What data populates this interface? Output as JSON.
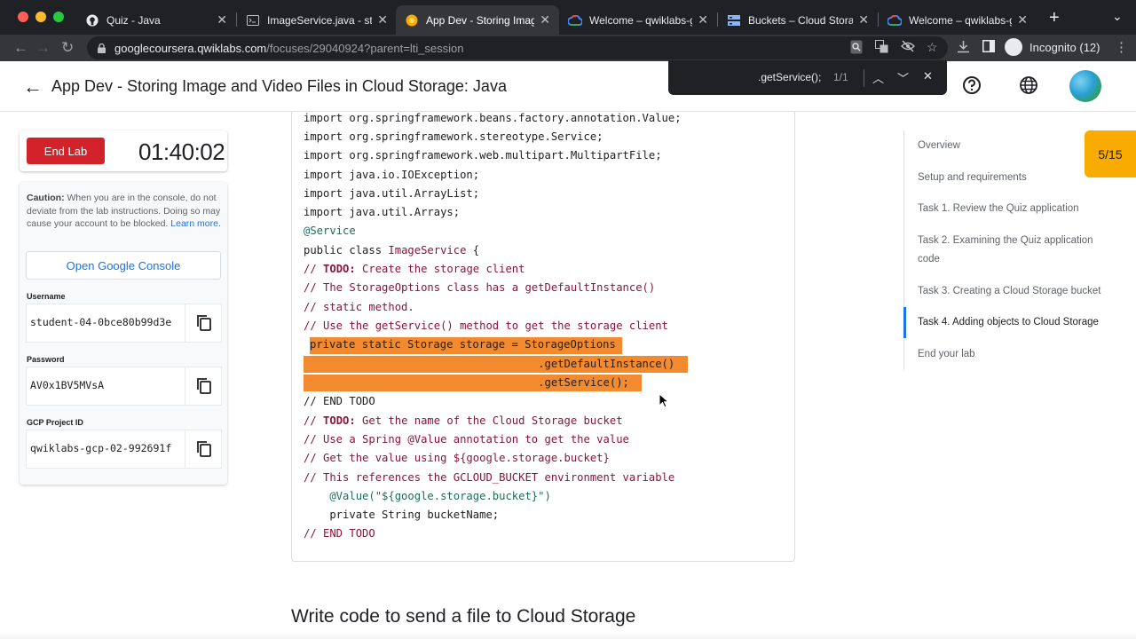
{
  "browser": {
    "tabs": [
      {
        "title": "Quiz - Java",
        "icon": "github-icon",
        "active": false
      },
      {
        "title": "ImageService.java - stud",
        "icon": "code-editor-icon",
        "active": false
      },
      {
        "title": "App Dev - Storing Image",
        "icon": "qwiklabs-icon",
        "active": true
      },
      {
        "title": "Welcome – qwiklabs-gcp",
        "icon": "google-cloud-icon",
        "active": false
      },
      {
        "title": "Buckets – Cloud Storage",
        "icon": "cloud-storage-icon",
        "active": false
      },
      {
        "title": "Welcome – qwiklabs-gcp",
        "icon": "google-cloud-icon",
        "active": false
      }
    ],
    "new_tab": "+",
    "url_host": "googlecoursera.qwiklabs.com",
    "url_path": "/focuses/29040924?parent=lti_session",
    "incognito_label": "Incognito (12)"
  },
  "find": {
    "query": ".getService();",
    "count": "1/1"
  },
  "header": {
    "title": "App Dev - Storing Image and Video Files in Cloud Storage: Java"
  },
  "lab": {
    "end_lab_label": "End Lab",
    "timer": "01:40:02",
    "caution_bold": "Caution:",
    "caution_text": " When you are in the console, do not deviate from the lab instructions. Doing so may cause your account to be blocked. ",
    "learn_more": "Learn more.",
    "console_button": "Open Google Console",
    "username_label": "Username",
    "username_value": "student-04-0bce80b99d3e",
    "password_label": "Password",
    "password_value": "AV0x1BV5MVsA",
    "project_label": "GCP Project ID",
    "project_value": "qwiklabs-gcp-02-992691f"
  },
  "code": {
    "l1": "import org.springframework.beans.factory.annotation.Value;",
    "l2": "import org.springframework.stereotype.Service;",
    "l3": "import org.springframework.web.multipart.MultipartFile;",
    "l4": "import java.io.IOException;",
    "l5": "import java.util.ArrayList;",
    "l6": "import java.util.Arrays;",
    "l7": "@Service",
    "l8a": "public class ",
    "l8b": "ImageService",
    "l8c": " {",
    "l9a": "// ",
    "l9b": "TODO:",
    "l9c": " Create the storage client",
    "l10": "// The StorageOptions class has a getDefaultInstance()",
    "l11": "// static method.",
    "l12": "// Use the getService() method to get the storage client",
    "l13": "private static Storage storage = StorageOptions",
    "l14": "                                    .getDefaultInstance()",
    "l15": "                                    .getService();",
    "l16": "// END TODO",
    "l17a": "// ",
    "l17b": "TODO:",
    "l17c": " Get the name of the Cloud Storage bucket",
    "l18": "// Use a Spring @Value annotation to get the value",
    "l19": "// Get the value using ${google.storage.bucket}",
    "l20": "// This references the GCLOUD_BUCKET environment variable",
    "l21": "    @Value(\"${google.storage.bucket}\")",
    "l22": "    private String bucketName;",
    "l23": "// END TODO"
  },
  "toc": {
    "items": [
      "Overview",
      "Setup and requirements",
      "Task 1. Review the Quiz application",
      "Task 2. Examining the Quiz application code",
      "Task 3. Creating a Cloud Storage bucket",
      "Task 4. Adding objects to Cloud Storage",
      "End your lab"
    ],
    "active_index": 5,
    "progress": "5/15"
  },
  "section_heading": "Write code to send a file to Cloud Storage",
  "colors": {
    "end_lab": "#d2232a",
    "highlight": "#f28b30",
    "badge": "#f9ab00",
    "link": "#1a73e8"
  }
}
